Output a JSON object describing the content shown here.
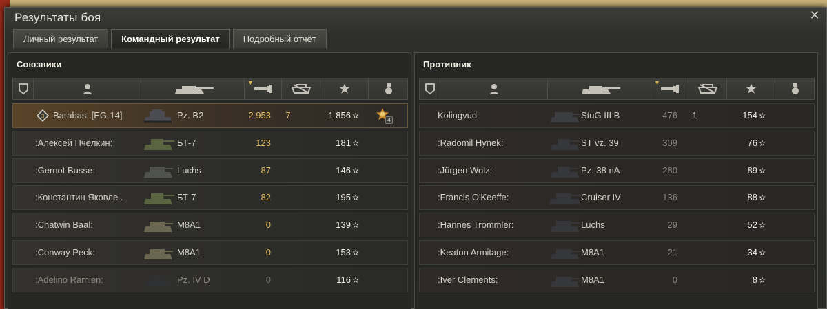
{
  "window": {
    "title": "Результаты боя",
    "close_label": "✕"
  },
  "tabs": [
    {
      "label": "Личный результат",
      "active": false
    },
    {
      "label": "Командный результат",
      "active": true
    },
    {
      "label": "Подробный отчёт",
      "active": false
    }
  ],
  "headers": [
    "platoon-icon",
    "player-icon",
    "tank-icon",
    "damage-icon",
    "kills-icon",
    "xp-star-icon",
    "medal-icon"
  ],
  "allies": {
    "title": "Союзники",
    "rows": [
      {
        "name": "Barabas..[EG-14]",
        "tank": "Pz. B2",
        "damage": "2 953",
        "kills": "7",
        "xp": "1 856",
        "medal_count": "4",
        "self": true,
        "dead": false
      },
      {
        "name": ":Алексей Пчёлкин:",
        "tank": "БТ-7",
        "damage": "123",
        "kills": "",
        "xp": "181",
        "self": false,
        "dead": false
      },
      {
        "name": ":Gernot Busse:",
        "tank": "Luchs",
        "damage": "87",
        "kills": "",
        "xp": "146",
        "self": false,
        "dead": false
      },
      {
        "name": ":Константин Яковле..",
        "tank": "БТ-7",
        "damage": "82",
        "kills": "",
        "xp": "195",
        "self": false,
        "dead": false
      },
      {
        "name": ":Chatwin Baal:",
        "tank": "M8A1",
        "damage": "0",
        "kills": "",
        "xp": "139",
        "self": false,
        "dead": false
      },
      {
        "name": ":Conway Peck:",
        "tank": "M8A1",
        "damage": "0",
        "kills": "",
        "xp": "153",
        "self": false,
        "dead": false
      },
      {
        "name": ":Adelino Ramien:",
        "tank": "Pz. IV D",
        "damage": "0",
        "kills": "",
        "xp": "116",
        "self": false,
        "dead": true
      }
    ]
  },
  "enemies": {
    "title": "Противник",
    "rows": [
      {
        "name": "Kolingvud",
        "tank": "StuG III B",
        "damage": "476",
        "kills": "1",
        "xp": "154"
      },
      {
        "name": ":Radomil Hynek:",
        "tank": "ST vz. 39",
        "damage": "309",
        "kills": "",
        "xp": "76"
      },
      {
        "name": ":Jürgen Wolz:",
        "tank": "Pz. 38 nA",
        "damage": "280",
        "kills": "",
        "xp": "89"
      },
      {
        "name": ":Francis O'Keeffe:",
        "tank": "Cruiser IV",
        "damage": "136",
        "kills": "",
        "xp": "88"
      },
      {
        "name": ":Hannes Trommler:",
        "tank": "Luchs",
        "damage": "29",
        "kills": "",
        "xp": "52"
      },
      {
        "name": ":Keaton Armitage:",
        "tank": "M8A1",
        "damage": "21",
        "kills": "",
        "xp": "34"
      },
      {
        "name": ":Iver Clements:",
        "tank": "M8A1",
        "damage": "0",
        "kills": "",
        "xp": "8"
      }
    ]
  },
  "star_glyph": "✫"
}
